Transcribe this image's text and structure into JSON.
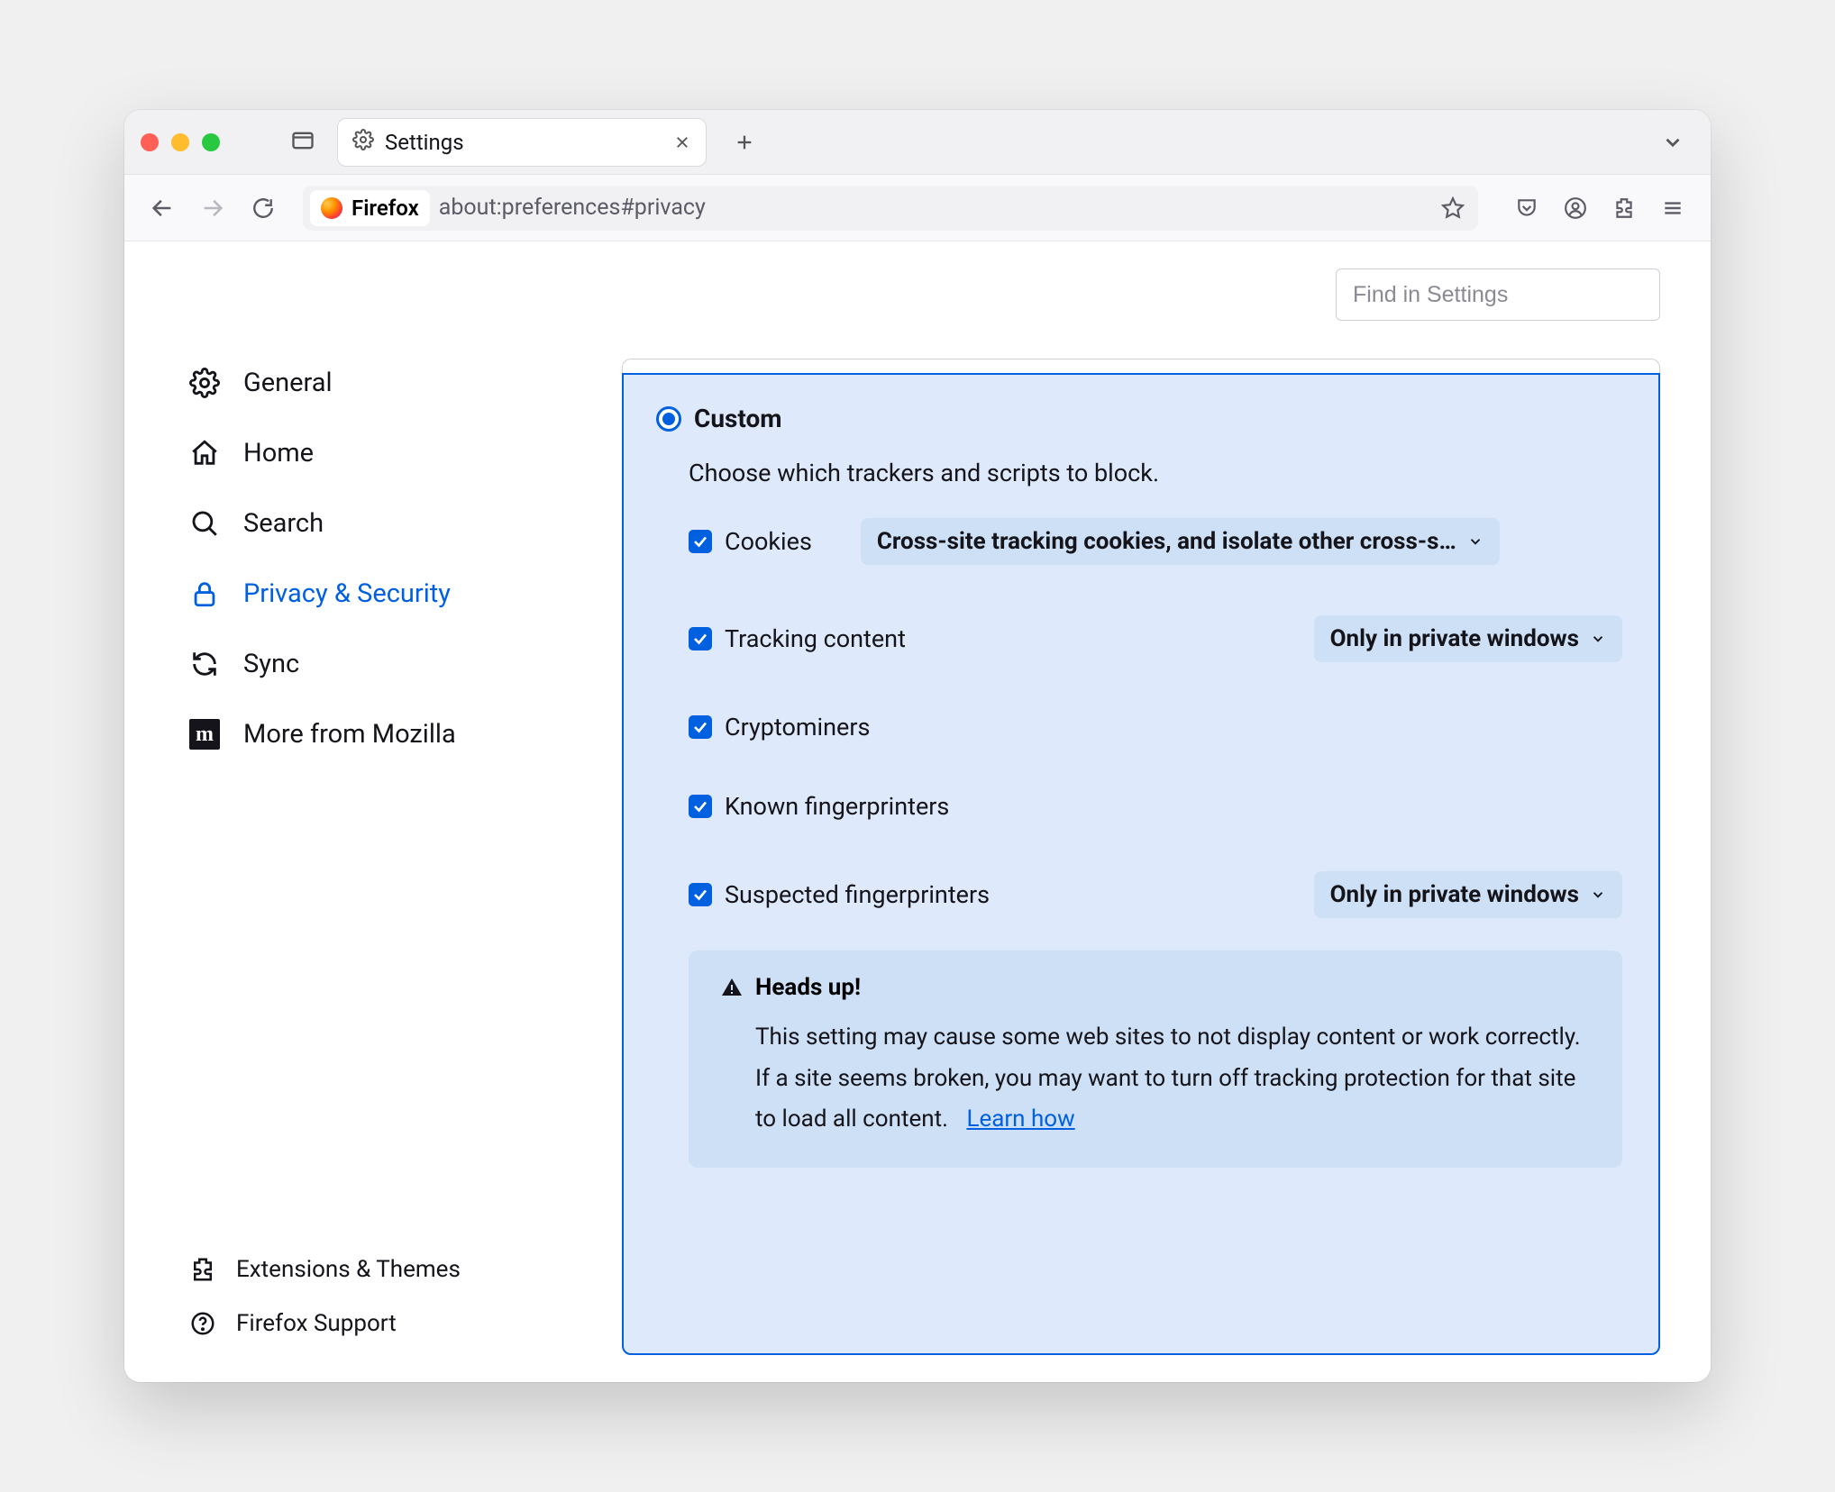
{
  "tab": {
    "title": "Settings"
  },
  "urlbar": {
    "badge": "Firefox",
    "url": "about:preferences#privacy"
  },
  "search": {
    "placeholder": "Find in Settings"
  },
  "sidebar": {
    "items": [
      {
        "label": "General"
      },
      {
        "label": "Home"
      },
      {
        "label": "Search"
      },
      {
        "label": "Privacy & Security"
      },
      {
        "label": "Sync"
      },
      {
        "label": "More from Mozilla"
      }
    ],
    "bottom": [
      {
        "label": "Extensions & Themes"
      },
      {
        "label": "Firefox Support"
      }
    ]
  },
  "panel": {
    "title": "Custom",
    "desc": "Choose which trackers and scripts to block.",
    "options": {
      "cookies": {
        "label": "Cookies",
        "select": "Cross-site tracking cookies, and isolate other cross-s…"
      },
      "tracking": {
        "label": "Tracking content",
        "select": "Only in private windows"
      },
      "cryptominers": {
        "label": "Cryptominers"
      },
      "known_fp": {
        "label": "Known fingerprinters"
      },
      "suspected_fp": {
        "label": "Suspected fingerprinters",
        "select": "Only in private windows"
      }
    },
    "headsup": {
      "title": "Heads up!",
      "body": "This setting may cause some web sites to not display content or work correctly. If a site seems broken, you may want to turn off tracking protection for that site to load all content.",
      "link": "Learn how"
    }
  }
}
